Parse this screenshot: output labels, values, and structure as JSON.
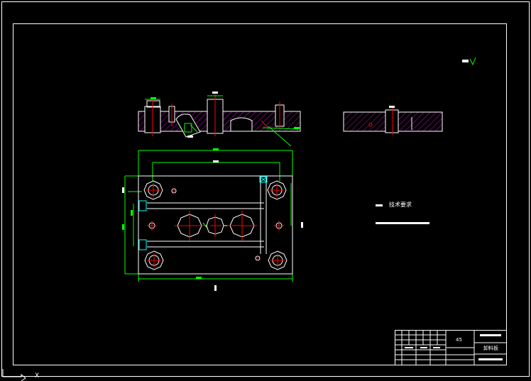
{
  "drawing": {
    "technical_requirements_heading": "技术要求",
    "title_block": {
      "material": "45",
      "part_name": "卸料板"
    },
    "axis_indicator": "X"
  },
  "colors": {
    "background": "#000000",
    "outline": "#ffffff",
    "dimension": "#00ff00",
    "centerline": "#ff0000",
    "hatch": "#ff00ff",
    "hidden": "#00ffff"
  }
}
